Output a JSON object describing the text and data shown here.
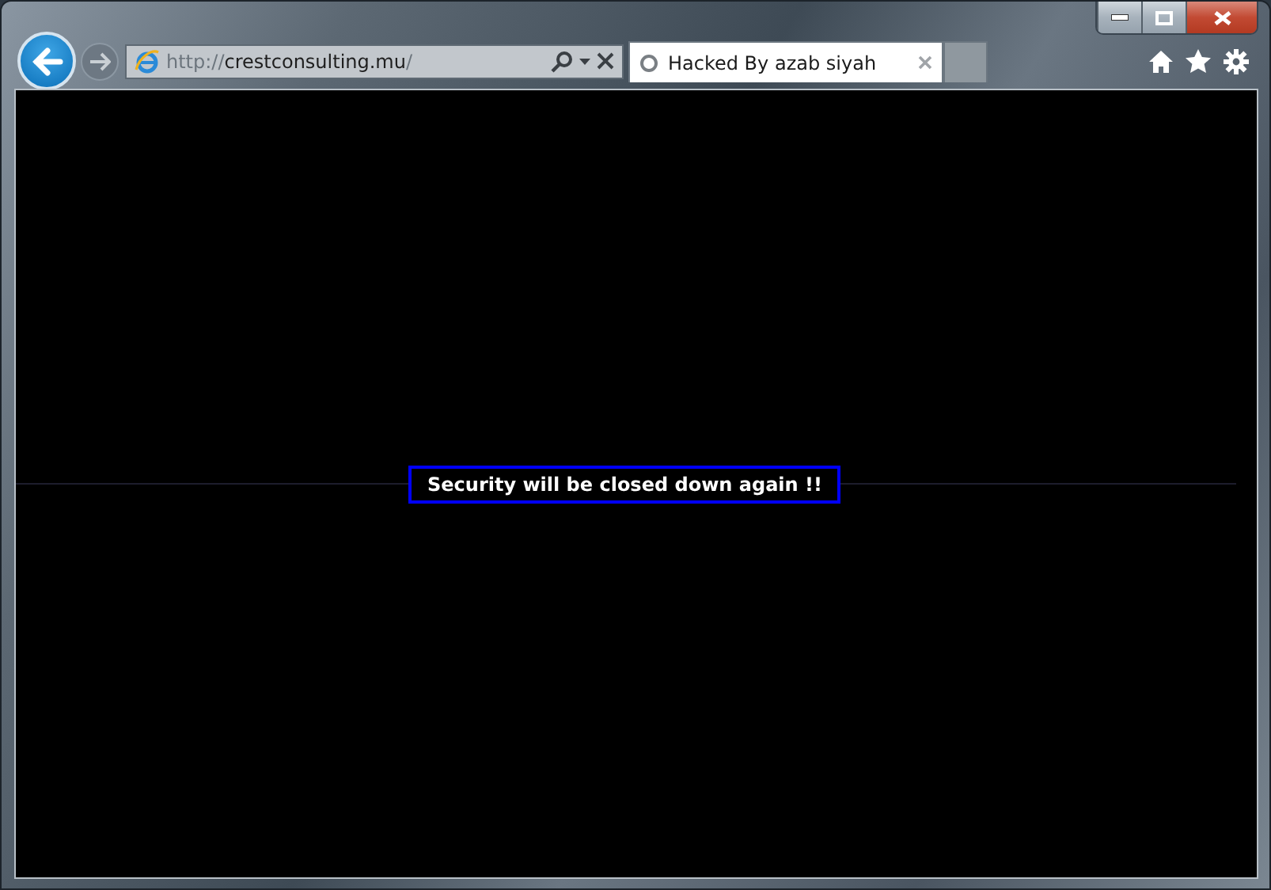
{
  "address_bar": {
    "url_parts": [
      {
        "text": "http://",
        "dim": true
      },
      {
        "text": "crestconsulting.mu",
        "dim": false
      },
      {
        "text": "/",
        "dim": true
      }
    ]
  },
  "tabs": [
    {
      "label": "Hacked By azab siyah",
      "selected": true
    }
  ],
  "page": {
    "message": "Security will be closed down again !!"
  }
}
